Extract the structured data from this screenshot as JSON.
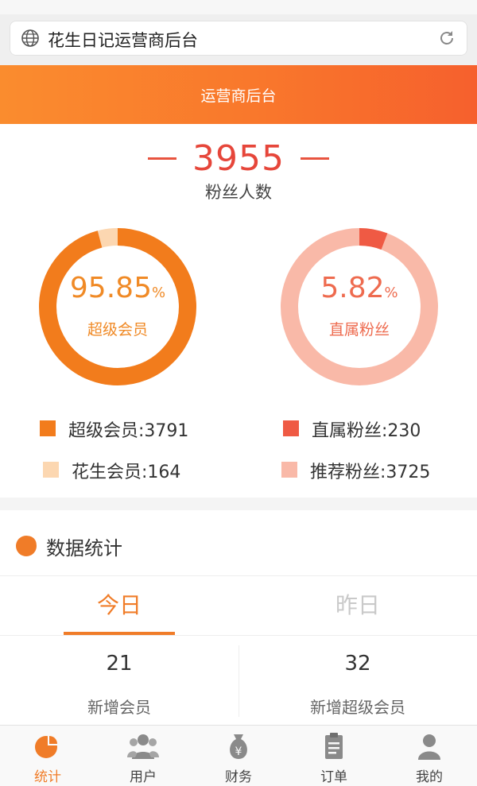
{
  "browser": {
    "url_title": "花生日记运营商后台"
  },
  "header": {
    "title": "运营商后台"
  },
  "fans": {
    "total": "3955",
    "label": "粉丝人数"
  },
  "rings": [
    {
      "percent": "95.85",
      "unit": "%",
      "label": "超级会员",
      "value": 0.9585,
      "color": "#f27c1c",
      "track": "#fcd7b1",
      "text_color": "#f08a26"
    },
    {
      "percent": "5.82",
      "unit": "%",
      "label": "直属粉丝",
      "value": 0.0582,
      "color": "#ef5a44",
      "track": "#f9b9a8",
      "text_color": "#ee6b4f"
    }
  ],
  "legend": [
    {
      "text": "超级会员:3791",
      "color": "#f27c1c"
    },
    {
      "text": "直属粉丝:230",
      "color": "#ef5a44"
    },
    {
      "text": "花生会员:164",
      "color": "#fcd7b1"
    },
    {
      "text": "推荐粉丝:3725",
      "color": "#f9b9a8"
    }
  ],
  "stats": {
    "title": "数据统计",
    "tabs": [
      {
        "label": "今日"
      },
      {
        "label": "昨日"
      }
    ],
    "items": [
      {
        "value": "21",
        "label": "新增会员"
      },
      {
        "value": "32",
        "label": "新增超级会员"
      }
    ]
  },
  "tabbar": {
    "items": [
      {
        "label": "统计",
        "icon": "pie-chart-icon",
        "active": true
      },
      {
        "label": "用户",
        "icon": "users-icon",
        "active": false
      },
      {
        "label": "财务",
        "icon": "money-bag-icon",
        "active": false
      },
      {
        "label": "订单",
        "icon": "clipboard-icon",
        "active": false
      },
      {
        "label": "我的",
        "icon": "person-icon",
        "active": false
      }
    ]
  },
  "colors": {
    "accent": "#f07c28",
    "header_gradient_start": "#fa8c2e",
    "header_gradient_end": "#f6602d"
  }
}
